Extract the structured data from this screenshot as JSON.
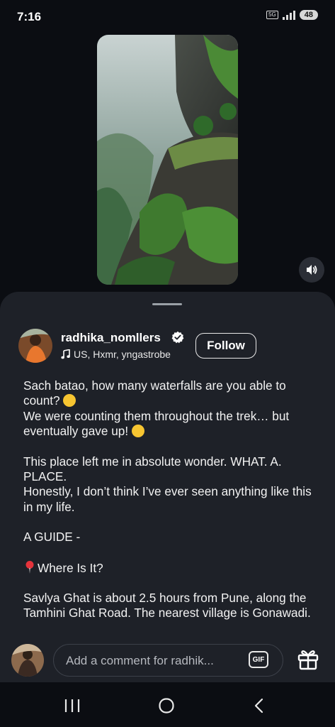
{
  "status_bar": {
    "time": "7:16",
    "network": "5G",
    "battery": "48"
  },
  "post": {
    "username": "radhika_nomllers",
    "verified": true,
    "audio": "US, Hxmr, yngastrobe",
    "follow_label": "Follow",
    "caption": {
      "line1": "Sach batao, how many waterfalls are you able to count?",
      "line2": "We were counting them throughout the trek… but eventually gave up!",
      "line3": "This place left me in absolute wonder. WHAT. A. PLACE.",
      "line4": "Honestly, I don’t think I’ve ever seen anything like this in my life.",
      "line5": "A GUIDE -",
      "line6": "Where Is It?",
      "line7": "Savlya Ghat is about 2.5 hours from Pune, along the Tamhini Ghat Road. The nearest village is Gonawadi."
    }
  },
  "comment": {
    "placeholder": "Add a comment for radhik...",
    "gif_label": "GIF"
  },
  "icons": {
    "mute": "volume-icon",
    "verified": "verified-badge-icon",
    "music": "music-note-icon",
    "gift": "gift-icon",
    "nav": [
      "recent-apps-icon",
      "home-icon",
      "back-icon"
    ]
  },
  "colors": {
    "background": "#0b0d12",
    "sheet": "#1e2128",
    "verified": "#ffffff"
  }
}
